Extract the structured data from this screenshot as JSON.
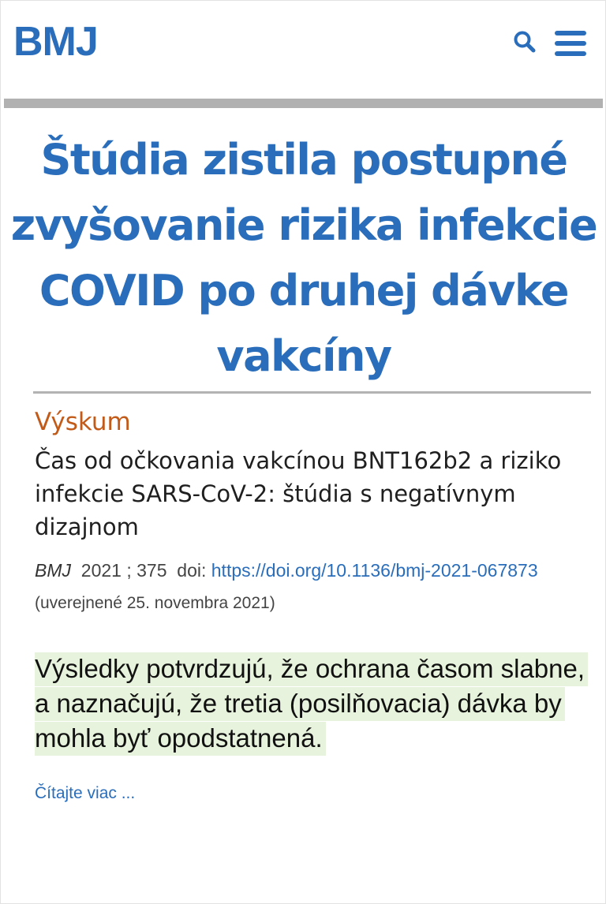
{
  "header": {
    "logo_text": "BMJ",
    "search_icon": "search-icon",
    "menu_icon": "hamburger-menu-icon",
    "brand_color": "#2a6ebb"
  },
  "headline": {
    "lines": [
      "Štúdia zistila postupné",
      "zvyšovanie rizika infekcie",
      "COVID po druhej dávke",
      "vakcíny"
    ]
  },
  "article": {
    "category": "Výskum",
    "category_color": "#c25b19",
    "title": "Čas od očkovania vakcínou BNT162b2 a riziko infekcie SARS-CoV-2: štúdia s negatívnym dizajnom",
    "citation": {
      "journal": "BMJ",
      "year_volume": "2021 ; 375",
      "doi_label": "doi:",
      "doi_url": "https://doi.org/10.1136/bmj-2021-067873",
      "published": "(uverejnené 25. novembra 2021)"
    }
  },
  "summary": {
    "text": "Výsledky potvrdzujú, že ochrana časom slabne, a naznačujú, že tretia (posilňovacia) dávka by mohla byť opodstatnená.",
    "highlight_color": "#e7f3dc"
  },
  "read_more": {
    "label": "Čítajte viac ..."
  }
}
